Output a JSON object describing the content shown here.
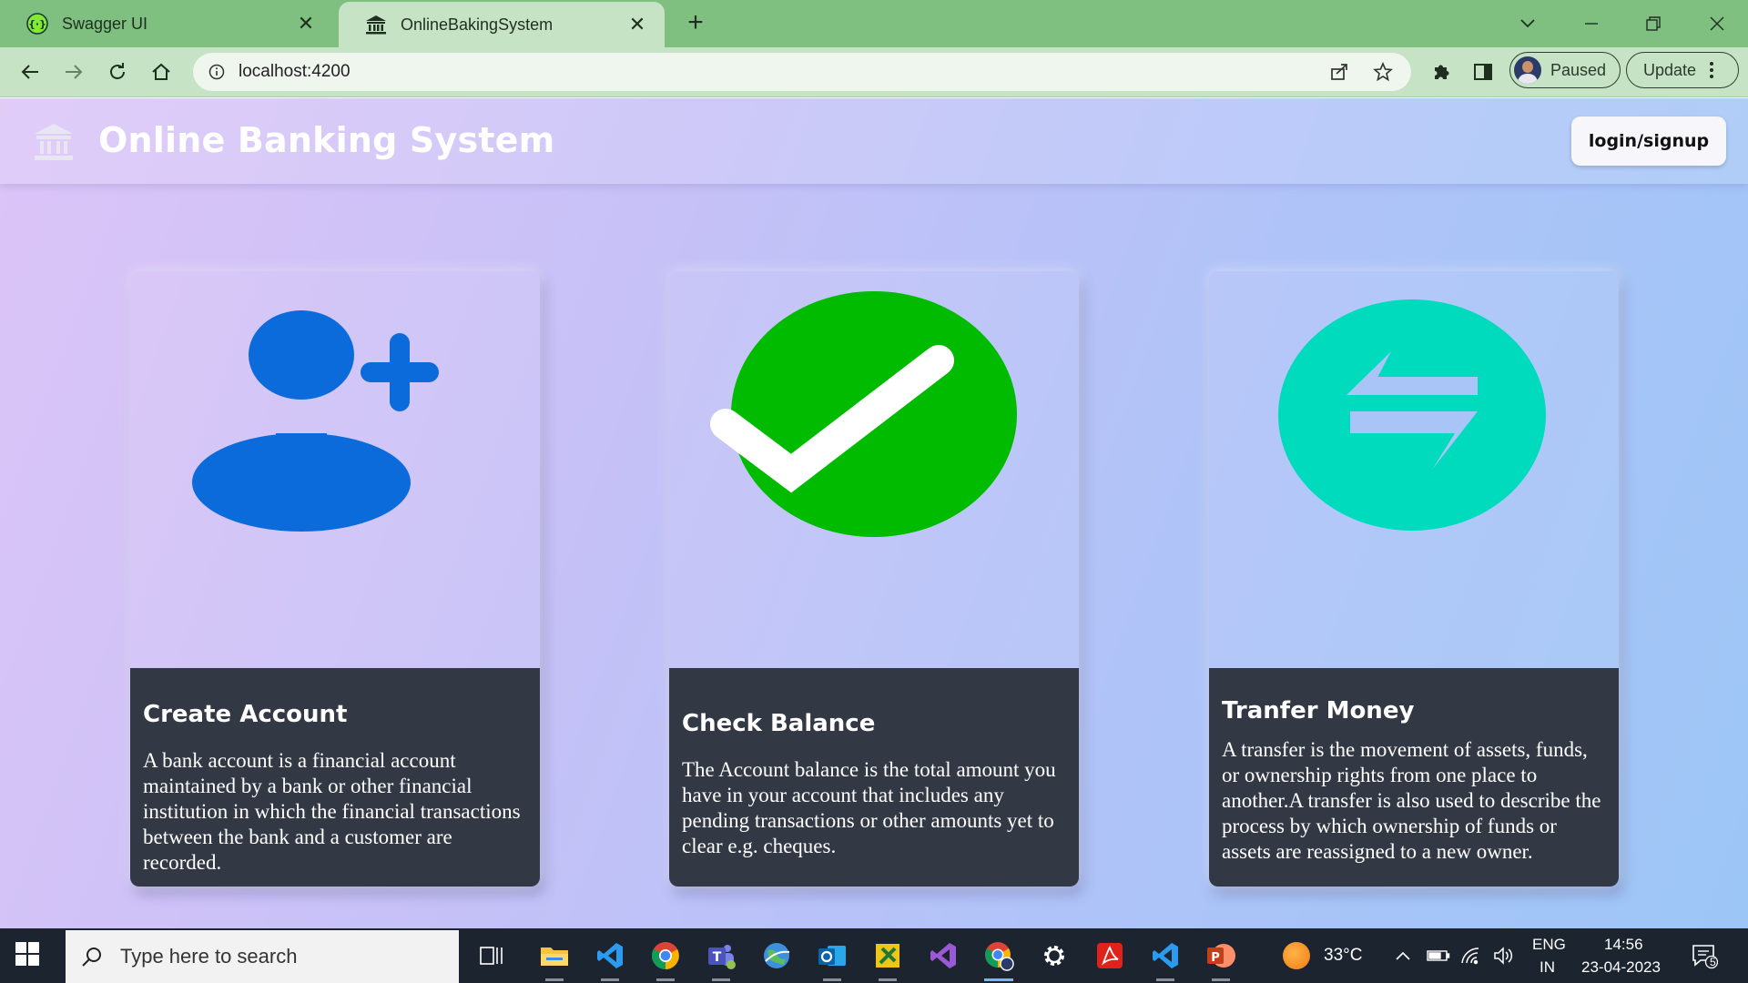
{
  "browser": {
    "tabs": [
      {
        "title": "Swagger UI",
        "favicon": "swagger-icon",
        "active": false
      },
      {
        "title": "OnlineBakingSystem",
        "favicon": "bank-icon",
        "active": true
      }
    ],
    "url": "localhost:4200",
    "profile_status": "Paused",
    "update_label": "Update"
  },
  "app": {
    "brand": "Online Banking System",
    "login_label": "login/signup"
  },
  "cards": [
    {
      "title": "Create Account",
      "icon": "add-user-icon",
      "text": "A bank account is a financial account maintained by a bank or other financial institution in which the financial transactions between the bank and a customer are recorded."
    },
    {
      "title": "Check Balance",
      "icon": "check-circle-icon",
      "text": "The Account balance is the total amount you have in your account that includes any pending transactions or other amounts yet to clear e.g. cheques."
    },
    {
      "title": "Tranfer Money",
      "icon": "transfer-icon",
      "text": "A transfer is the movement of assets, funds, or ownership rights from one place to another.A transfer is also used to describe the process by which ownership of funds or assets are reassigned to a new owner."
    }
  ],
  "colors": {
    "add_user_blue": "#0b6bdb",
    "check_green": "#00bb00",
    "transfer_teal": "#00dbbd",
    "card_body": "#333845"
  },
  "taskbar": {
    "search_placeholder": "Type here to search",
    "weather": "33°C",
    "lang_top": "ENG",
    "lang_bottom": "IN",
    "time": "14:56",
    "date": "23-04-2023",
    "notification_count": "5"
  }
}
